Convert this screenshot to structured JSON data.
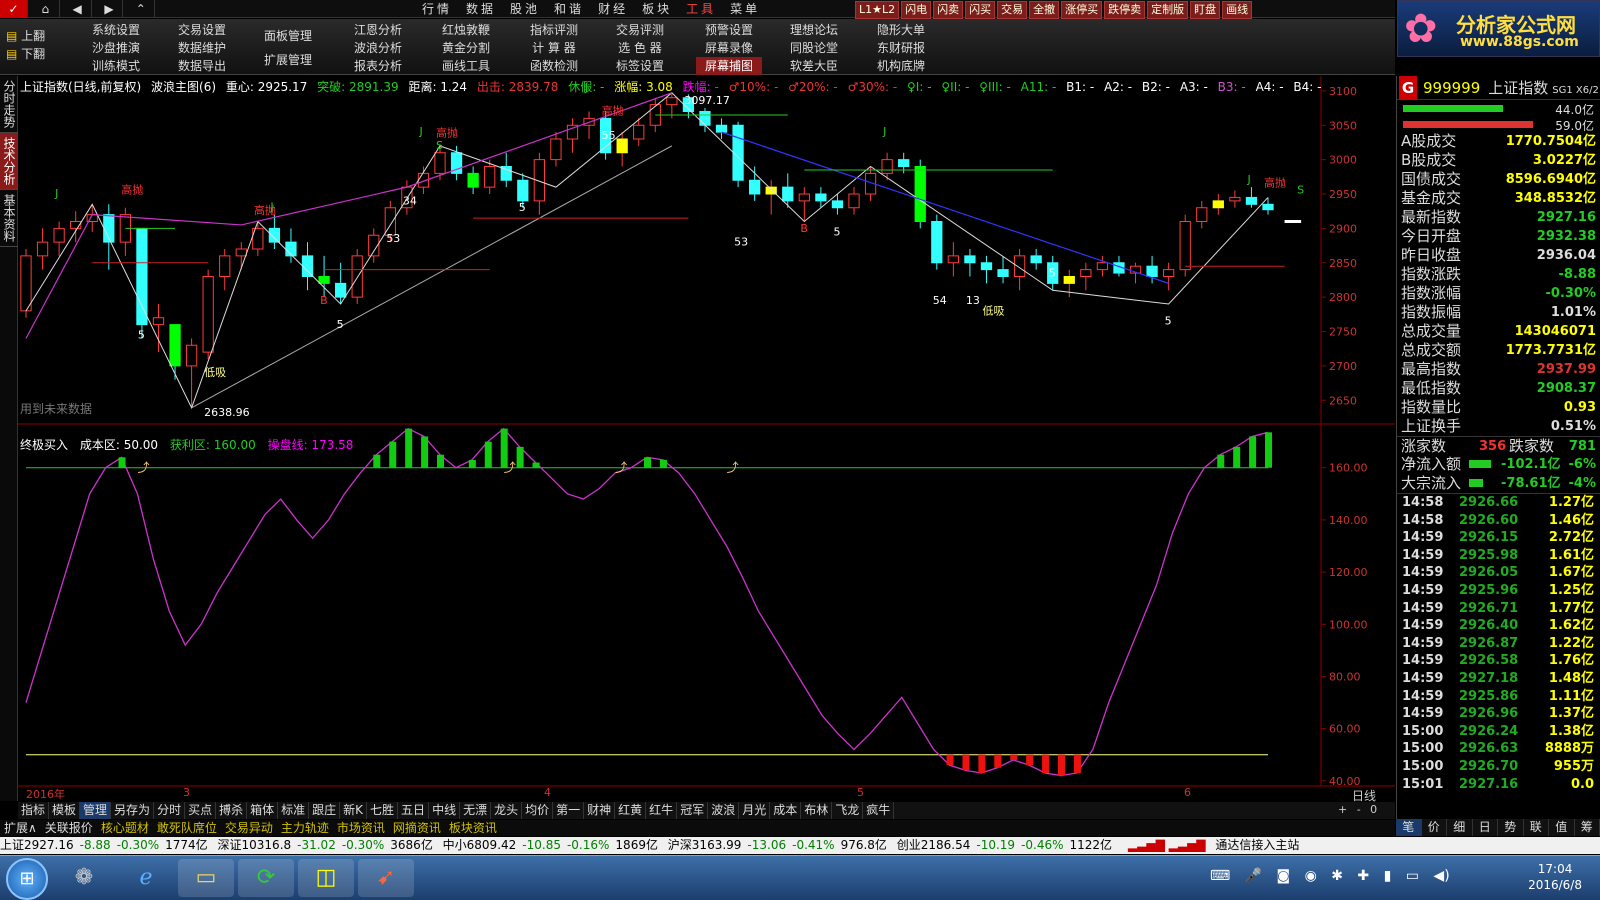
{
  "topbar": {
    "nav": [
      "⌂",
      "◀",
      "▶",
      "⌃"
    ],
    "menu": [
      "行情",
      "数据",
      "股池",
      "和谐",
      "财经",
      "板块",
      "工具",
      "菜单"
    ],
    "quick": [
      "L1★L2",
      "闪电",
      "闪卖",
      "闪买",
      "交易",
      "全撤",
      "涨停买",
      "跌停卖",
      "定制版",
      "盯盘",
      "画线"
    ]
  },
  "toolbar": {
    "nav": [
      "上翻",
      "下翻"
    ],
    "cols": [
      [
        "系统设置",
        "沙盘推演",
        "训练模式"
      ],
      [
        "交易设置",
        "数据维护",
        "数据导出"
      ],
      [
        "",
        "面板管理",
        "扩展管理"
      ],
      [
        "江恩分析",
        "波浪分析",
        "报表分析"
      ],
      [
        "红烛敦鞭",
        "黄金分割",
        "画线工具"
      ],
      [
        "指标评测",
        "计 算 器",
        "函数检测"
      ],
      [
        "交易评测",
        "选 色 器",
        "标签设置"
      ],
      [
        "预警设置",
        "屏幕录像",
        "屏幕捕图"
      ],
      [
        "理想论坛",
        "同股论堂",
        "软差大臣"
      ],
      [
        "隐形大单",
        "东财研报",
        "机构底牌"
      ]
    ]
  },
  "logo": {
    "title": "分析家公式网",
    "url": "www.88gs.com"
  },
  "lefttabs": [
    "分时走势",
    "技术分析",
    "基本资料"
  ],
  "chart": {
    "info": [
      "上证指数(日线,前复权)",
      "波浪主图(6)",
      "重心: 2925.17",
      "突破: 2891.39",
      "距离: 1.24",
      "出击: 2839.78",
      "休假: -",
      "涨幅: 3.08",
      "跌幅: -",
      "♂10%: -",
      "♂20%: -",
      "♂30%: -",
      "♀I: -",
      "♀II: -",
      "♀III: -",
      "A11: -",
      "B1: -",
      "A2: -",
      "B2: -",
      "A3: -",
      "B3: -",
      "A4: -",
      "B4: -"
    ],
    "price_scale": [
      "3100",
      "3050",
      "3000",
      "2950",
      "2900",
      "2850",
      "2800",
      "2750",
      "2700",
      "2650"
    ],
    "future_note": "用到未来数据",
    "labels": {
      "high_mark": "3097.17",
      "low_mark": "2638.96",
      "high_sell": "高抛",
      "low_buy": "低吸",
      "j": "J",
      "s": "S",
      "b": "B",
      "n5": "5",
      "n53": "53",
      "n54": "54",
      "n13": "13",
      "n34": "34",
      "n55": "55",
      "n3": "3"
    },
    "ind2": {
      "title": "终极买入",
      "cost": "成本区: 50.00",
      "profit": "获利区: 160.00",
      "trader": "操盘线: 173.58"
    },
    "ind2_scale": [
      "160.00",
      "140.00",
      "120.00",
      "100.00",
      "80.00",
      "60.00",
      "40.00"
    ],
    "xaxis": [
      "2016年",
      "3",
      "4",
      "5",
      "6"
    ],
    "period": "日线"
  },
  "chart_data": {
    "type": "candlestick",
    "series": [
      {
        "name": "上证指数",
        "ohlc": [
          [
            2780,
            2870,
            2770,
            2860
          ],
          [
            2860,
            2900,
            2840,
            2880
          ],
          [
            2880,
            2910,
            2860,
            2900
          ],
          [
            2900,
            2925,
            2880,
            2910
          ],
          [
            2910,
            2935,
            2895,
            2920
          ],
          [
            2920,
            2935,
            2840,
            2880
          ],
          [
            2880,
            2930,
            2860,
            2920
          ],
          [
            2900,
            2900,
            2740,
            2760
          ],
          [
            2760,
            2790,
            2720,
            2770
          ],
          [
            2760,
            2760,
            2680,
            2700
          ],
          [
            2700,
            2740,
            2638.96,
            2730
          ],
          [
            2720,
            2840,
            2710,
            2830
          ],
          [
            2830,
            2870,
            2810,
            2860
          ],
          [
            2860,
            2880,
            2840,
            2870
          ],
          [
            2870,
            2910,
            2860,
            2900
          ],
          [
            2900,
            2920,
            2870,
            2880
          ],
          [
            2880,
            2900,
            2850,
            2860
          ],
          [
            2860,
            2880,
            2810,
            2830
          ],
          [
            2830,
            2860,
            2800,
            2820
          ],
          [
            2820,
            2850,
            2790,
            2800
          ],
          [
            2800,
            2870,
            2790,
            2860
          ],
          [
            2860,
            2900,
            2850,
            2890
          ],
          [
            2890,
            2940,
            2880,
            2930
          ],
          [
            2930,
            2970,
            2920,
            2960
          ],
          [
            2960,
            2990,
            2950,
            2980
          ],
          [
            2980,
            3020,
            2970,
            3010
          ],
          [
            3010,
            3020,
            2970,
            2980
          ],
          [
            2980,
            2990,
            2950,
            2960
          ],
          [
            2960,
            3000,
            2950,
            2990
          ],
          [
            2990,
            3010,
            2960,
            2970
          ],
          [
            2970,
            2980,
            2930,
            2940
          ],
          [
            2940,
            3010,
            2920,
            3000
          ],
          [
            3000,
            3040,
            2990,
            3030
          ],
          [
            3030,
            3060,
            3010,
            3050
          ],
          [
            3050,
            3070,
            3030,
            3060
          ],
          [
            3060,
            3070,
            3000,
            3010
          ],
          [
            3010,
            3040,
            2990,
            3030
          ],
          [
            3030,
            3060,
            3020,
            3050
          ],
          [
            3050,
            3090,
            3040,
            3080
          ],
          [
            3080,
            3097.17,
            3060,
            3090
          ],
          [
            3090,
            3095,
            3060,
            3070
          ],
          [
            3070,
            3075,
            3040,
            3050
          ],
          [
            3050,
            3060,
            3030,
            3040
          ],
          [
            3050,
            3055,
            2960,
            2970
          ],
          [
            2970,
            2990,
            2940,
            2950
          ],
          [
            2950,
            2970,
            2920,
            2960
          ],
          [
            2960,
            2980,
            2930,
            2940
          ],
          [
            2940,
            2960,
            2910,
            2950
          ],
          [
            2950,
            2960,
            2930,
            2940
          ],
          [
            2940,
            2950,
            2920,
            2930
          ],
          [
            2930,
            2960,
            2920,
            2950
          ],
          [
            2950,
            2990,
            2940,
            2980
          ],
          [
            2980,
            3010,
            2970,
            3000
          ],
          [
            3000,
            3010,
            2980,
            2990
          ],
          [
            2990,
            3000,
            2900,
            2910
          ],
          [
            2910,
            2920,
            2840,
            2850
          ],
          [
            2850,
            2880,
            2830,
            2860
          ],
          [
            2860,
            2870,
            2830,
            2850
          ],
          [
            2850,
            2860,
            2820,
            2840
          ],
          [
            2840,
            2860,
            2820,
            2830
          ],
          [
            2830,
            2870,
            2810,
            2860
          ],
          [
            2860,
            2870,
            2840,
            2850
          ],
          [
            2850,
            2860,
            2810,
            2820
          ],
          [
            2820,
            2840,
            2800,
            2830
          ],
          [
            2830,
            2850,
            2810,
            2840
          ],
          [
            2840,
            2860,
            2830,
            2850
          ],
          [
            2850,
            2860,
            2830,
            2835
          ],
          [
            2835,
            2850,
            2820,
            2845
          ],
          [
            2845,
            2860,
            2820,
            2830
          ],
          [
            2830,
            2850,
            2810,
            2840
          ],
          [
            2840,
            2920,
            2830,
            2910
          ],
          [
            2910,
            2940,
            2900,
            2930
          ],
          [
            2930,
            2950,
            2920,
            2940
          ],
          [
            2940,
            2955,
            2930,
            2945
          ],
          [
            2945,
            2960,
            2930,
            2935
          ],
          [
            2935,
            2945,
            2920,
            2927.16
          ]
        ]
      }
    ],
    "ind2_series": [
      {
        "name": "操盘线",
        "values": [
          70,
          90,
          110,
          130,
          150,
          160,
          164,
          150,
          125,
          105,
          92,
          100,
          112,
          122,
          132,
          142,
          148,
          140,
          133,
          140,
          150,
          158,
          165,
          170,
          175,
          172,
          165,
          160,
          163,
          170,
          175,
          168,
          162,
          156,
          150,
          148,
          152,
          158,
          160,
          164,
          163,
          158,
          150,
          140,
          130,
          118,
          105,
          95,
          85,
          75,
          65,
          58,
          52,
          58,
          65,
          72,
          62,
          52,
          46,
          44,
          43,
          45,
          48,
          46,
          43,
          42,
          43,
          52,
          70,
          85,
          100,
          115,
          135,
          150,
          160,
          165,
          168,
          172,
          173.58
        ]
      }
    ],
    "ylim": [
      2630,
      3110
    ],
    "ind2_ylim": [
      38,
      176
    ]
  },
  "quote": {
    "code": "999999",
    "name": "上证指数",
    "tag": "SG1 X6/2",
    "bars": [
      {
        "value": "44.0亿",
        "color": "#2c2"
      },
      {
        "value": "59.0亿",
        "color": "#d33"
      }
    ],
    "rows": [
      {
        "label": "A股成交",
        "value": "1770.7504亿",
        "color": "#ff0"
      },
      {
        "label": "B股成交",
        "value": "3.0227亿",
        "color": "#ff0"
      },
      {
        "label": "国债成交",
        "value": "8596.6940亿",
        "color": "#ff0"
      },
      {
        "label": "基金成交",
        "value": "348.8532亿",
        "color": "#ff0"
      },
      {
        "label": "最新指数",
        "value": "2927.16",
        "color": "#2c2"
      },
      {
        "label": "今日开盘",
        "value": "2932.38",
        "color": "#2c2"
      },
      {
        "label": "昨日收盘",
        "value": "2936.04",
        "color": "#ddd"
      },
      {
        "label": "指数涨跌",
        "value": "-8.88",
        "color": "#2c2"
      },
      {
        "label": "指数涨幅",
        "value": "-0.30%",
        "color": "#2c2"
      },
      {
        "label": "指数振幅",
        "value": "1.01%",
        "color": "#ddd"
      },
      {
        "label": "总成交量",
        "value": "143046071",
        "color": "#ff0"
      },
      {
        "label": "总成交额",
        "value": "1773.7731亿",
        "color": "#ff0"
      },
      {
        "label": "最高指数",
        "value": "2937.99",
        "color": "#d33"
      },
      {
        "label": "最低指数",
        "value": "2908.37",
        "color": "#2c2"
      },
      {
        "label": "指数量比",
        "value": "0.93",
        "color": "#ff0"
      },
      {
        "label": "上证换手",
        "value": "0.51%",
        "color": "#ddd"
      }
    ],
    "updown": {
      "up_label": "涨家数",
      "up": "356",
      "down_label": "跌家数",
      "down": "781"
    },
    "flows": [
      {
        "label": "净流入额",
        "value": "-102.1亿",
        "pct": "-6%"
      },
      {
        "label": "大宗流入",
        "value": "-78.61亿",
        "pct": "-4%"
      }
    ],
    "ticks": [
      [
        "14:58",
        "2926.66",
        "1.27亿"
      ],
      [
        "14:58",
        "2926.60",
        "1.46亿"
      ],
      [
        "14:59",
        "2926.15",
        "2.72亿"
      ],
      [
        "14:59",
        "2925.98",
        "1.61亿"
      ],
      [
        "14:59",
        "2926.05",
        "1.67亿"
      ],
      [
        "14:59",
        "2925.96",
        "1.25亿"
      ],
      [
        "14:59",
        "2926.71",
        "1.77亿"
      ],
      [
        "14:59",
        "2926.40",
        "1.62亿"
      ],
      [
        "14:59",
        "2926.87",
        "1.22亿"
      ],
      [
        "14:59",
        "2926.58",
        "1.76亿"
      ],
      [
        "14:59",
        "2927.18",
        "1.48亿"
      ],
      [
        "14:59",
        "2925.86",
        "1.11亿"
      ],
      [
        "14:59",
        "2926.96",
        "1.37亿"
      ],
      [
        "15:00",
        "2926.24",
        "1.38亿"
      ],
      [
        "15:00",
        "2926.63",
        "8888万"
      ],
      [
        "15:00",
        "2926.70",
        "955万"
      ],
      [
        "15:01",
        "2927.16",
        "0.0"
      ]
    ],
    "tabs": [
      "笔",
      "价",
      "细",
      "日",
      "势",
      "联",
      "值",
      "筹"
    ]
  },
  "bottomtabs": [
    "指标",
    "模板",
    "管理",
    "另存为",
    "分时",
    "买点",
    "搏杀",
    "箱体",
    "标准",
    "跟庄",
    "新K",
    "七胜",
    "五日",
    "中线",
    "无漂",
    "龙头",
    "均价",
    "第一",
    "财神",
    "红黄",
    "红牛",
    "冠军",
    "波浪",
    "月光",
    "成本",
    "布林",
    "飞龙",
    "疯牛"
  ],
  "bottomtabs2": [
    "扩展∧",
    "关联报价",
    "核心题材",
    "敢死队席位",
    "交易异动",
    "主力轨迹",
    "市场资讯",
    "网摘资讯",
    "板块资讯"
  ],
  "zoom": "+ - 0",
  "status": {
    "sh": "上证2927.16",
    "sh_chg": "-8.88",
    "sh_pct": "-0.30%",
    "sh_amt": "1774亿",
    "sz": "深证10316.8",
    "sz_chg": "-31.02",
    "sz_pct": "-0.30%",
    "sz_amt": "3686亿",
    "zx": "中小6809.42",
    "zx_chg": "-10.85",
    "zx_pct": "-0.16%",
    "zx_amt": "1869亿",
    "hs": "沪深3163.99",
    "hs_chg": "-13.06",
    "hs_pct": "-0.41%",
    "hs_amt": "976.8亿",
    "cy": "创业2186.54",
    "cy_chg": "-10.19",
    "cy_pct": "-0.46%",
    "cy_amt": "1122亿",
    "conn": "通达信接入主站"
  },
  "clock": {
    "time": "17:04",
    "date": "2016/6/8"
  }
}
